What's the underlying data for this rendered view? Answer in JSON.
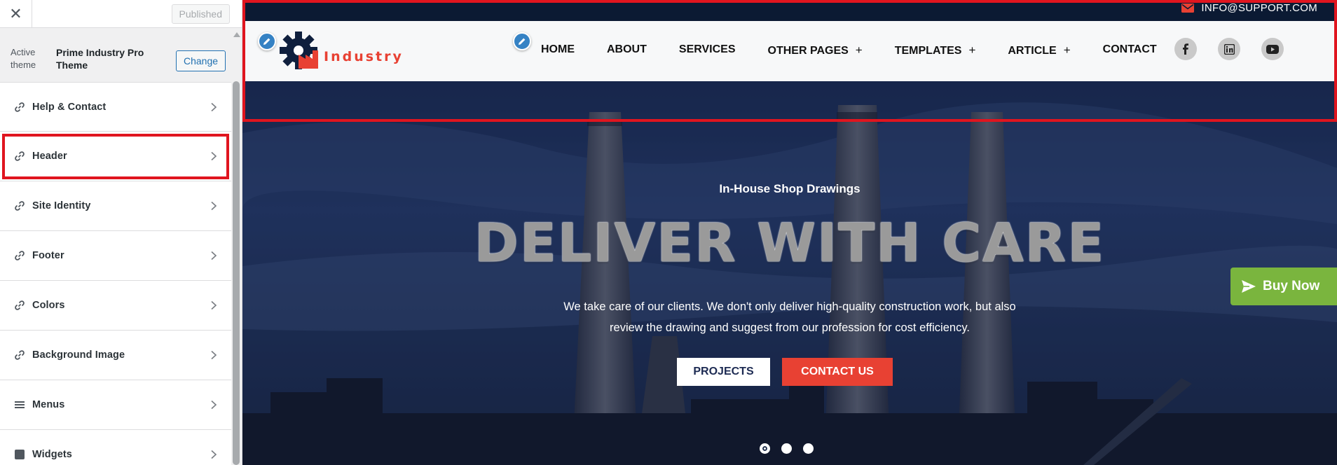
{
  "sidebar": {
    "close_glyph": "✕",
    "published_label": "Published",
    "active_theme_label": "Active theme",
    "theme_name": "Prime Industry Pro Theme",
    "change_label": "Change",
    "panels": [
      {
        "label": "Help & Contact",
        "icon": "link-icon",
        "highlighted": false
      },
      {
        "label": "Header",
        "icon": "link-icon",
        "highlighted": true
      },
      {
        "label": "Site Identity",
        "icon": "link-icon",
        "highlighted": false
      },
      {
        "label": "Footer",
        "icon": "link-icon",
        "highlighted": false
      },
      {
        "label": "Colors",
        "icon": "link-icon",
        "highlighted": false
      },
      {
        "label": "Background Image",
        "icon": "link-icon",
        "highlighted": false
      },
      {
        "label": "Menus",
        "icon": "menu-icon",
        "highlighted": false
      },
      {
        "label": "Widgets",
        "icon": "widgets-icon",
        "highlighted": false
      }
    ]
  },
  "preview": {
    "topbar": {
      "email": "INFO@SUPPORT.COM"
    },
    "logo_text": "Industry",
    "nav": [
      {
        "label": "HOME",
        "has_submenu": false
      },
      {
        "label": "ABOUT",
        "has_submenu": false
      },
      {
        "label": "SERVICES",
        "has_submenu": false
      },
      {
        "label": "OTHER PAGES",
        "has_submenu": true
      },
      {
        "label": "TEMPLATES",
        "has_submenu": true
      },
      {
        "label": "ARTICLE",
        "has_submenu": true
      },
      {
        "label": "CONTACT",
        "has_submenu": false
      }
    ],
    "submenu_glyph": "+",
    "social": [
      "facebook-icon",
      "linkedin-icon",
      "youtube-icon"
    ],
    "hero": {
      "subtitle": "In-House Shop Drawings",
      "title": "DELIVER WITH CARE",
      "description": "We take care of our clients. We don't only deliver high-quality construction work, but also review the drawing and suggest from our profession for cost efficiency.",
      "btn_projects": "PROJECTS",
      "btn_contact": "CONTACT US"
    },
    "slider_dots": 3,
    "active_dot": 0,
    "buy_now_label": "Buy Now",
    "colors": {
      "accent_red": "#e84133",
      "highlight_outline": "#e0151f",
      "buy_now_green": "#7ab53e",
      "wp_blue": "#2271b1",
      "topbar_navy": "#0b1a33"
    }
  }
}
